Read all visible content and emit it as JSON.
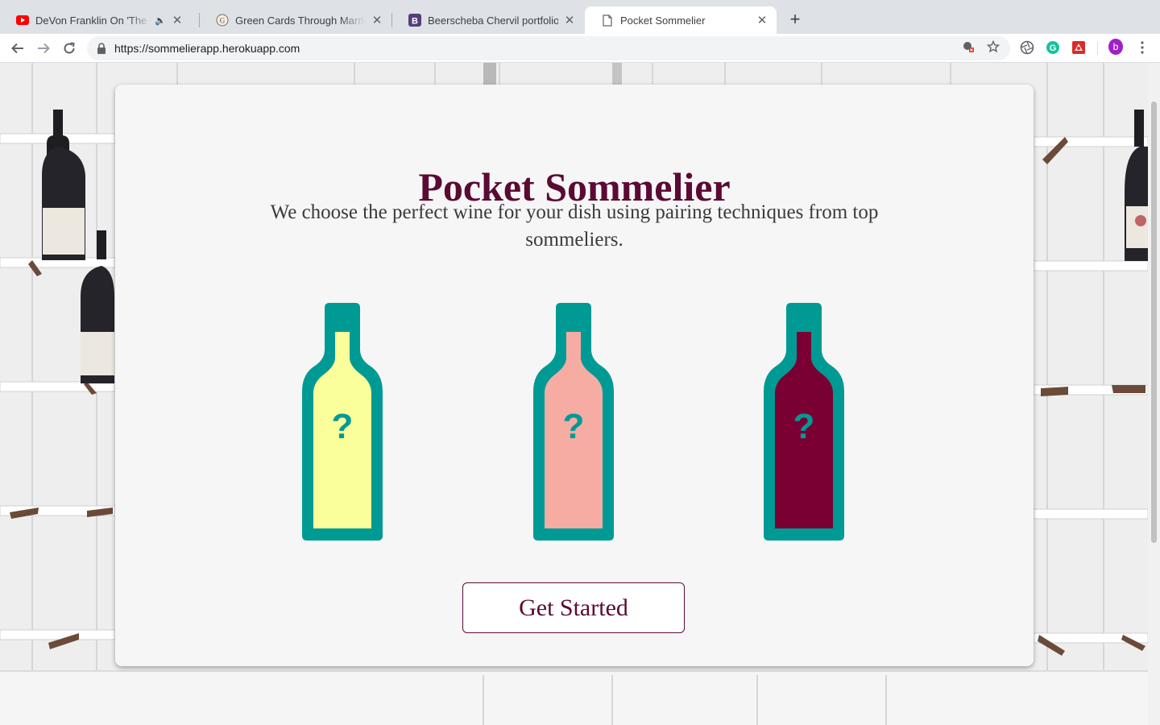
{
  "browser": {
    "tabs": [
      {
        "title": "DeVon Franklin On 'The Tru",
        "favicon": "youtube-icon",
        "audio": true
      },
      {
        "title": "Green Cards Through Marriage",
        "favicon": "law-firm-icon",
        "audio": false
      },
      {
        "title": "Beerscheba Chervil portfolio",
        "favicon": "bootstrap-icon",
        "audio": false
      },
      {
        "title": "Pocket Sommelier",
        "favicon": "page-icon",
        "audio": false,
        "active": true
      }
    ],
    "url": "https://sommelierapp.herokuapp.com",
    "profile_initial": "b"
  },
  "page": {
    "title": "Pocket Sommelier",
    "tagline": "We choose the perfect wine for your dish using pairing techniques from top sommeliers.",
    "bottles": [
      {
        "name": "white-wine",
        "fill": "#fbff9a",
        "mark": "?"
      },
      {
        "name": "rose-wine",
        "fill": "#f6aca3",
        "mark": "?"
      },
      {
        "name": "red-wine",
        "fill": "#7a0033",
        "mark": "?"
      }
    ],
    "cta_label": "Get Started"
  },
  "colors": {
    "brand": "#5b0a33",
    "teal": "#009a94",
    "background": "#f6f6f6"
  }
}
